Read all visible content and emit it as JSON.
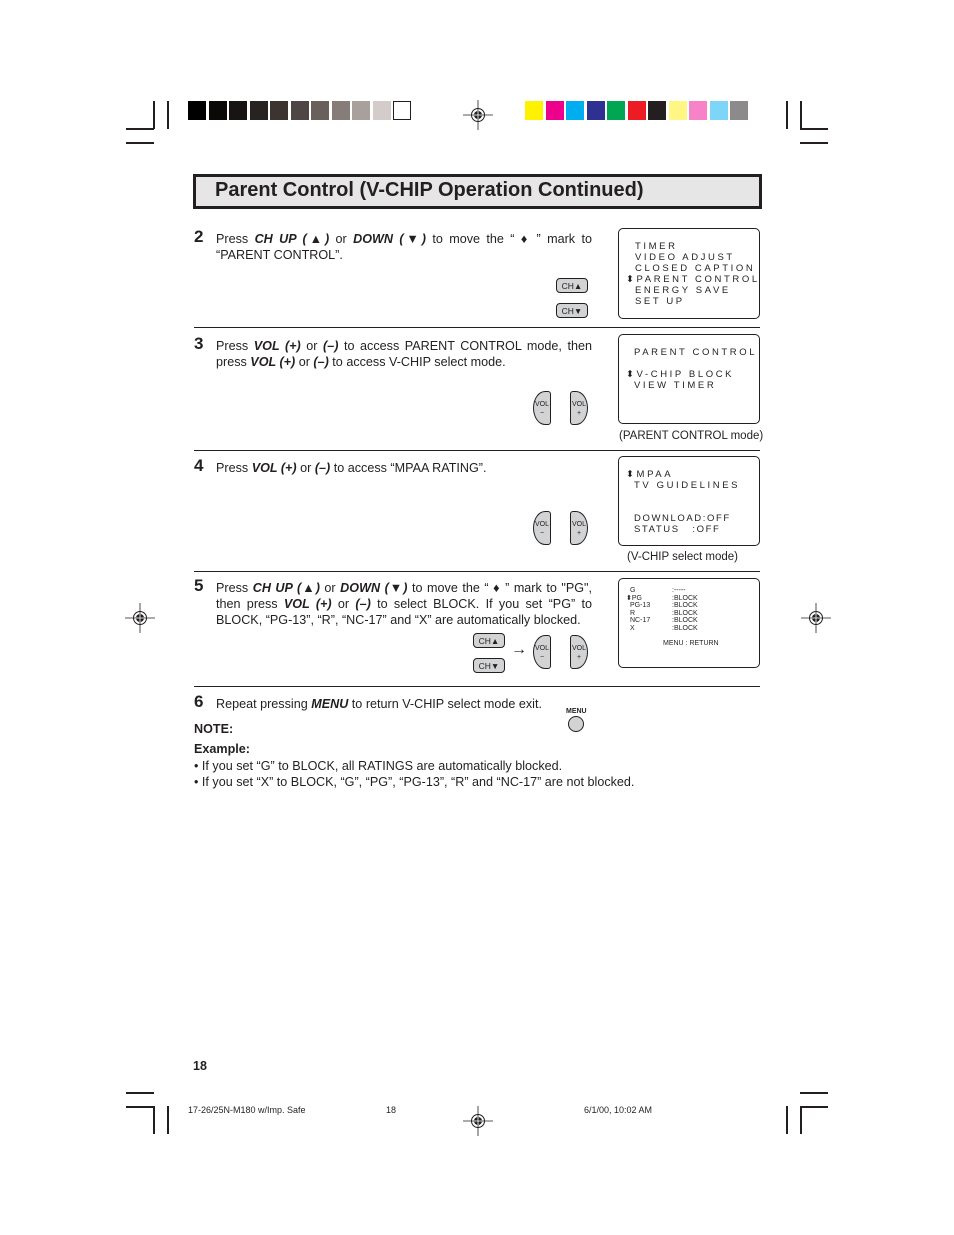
{
  "print_marks": {
    "gray_swatches": [
      "#000000",
      "#0a0908",
      "#171413",
      "#272320",
      "#3c3431",
      "#4e4644",
      "#6a605b",
      "#877d78",
      "#a8a09d",
      "#d4cccb",
      "#ffffff"
    ],
    "color_swatches": [
      "#fff200",
      "#ec008c",
      "#00aeef",
      "#2e3192",
      "#00a651",
      "#ed1c24",
      "#231f20",
      "#fff684",
      "#f683c7",
      "#7dd6f7",
      "#8c8a8a"
    ]
  },
  "header": {
    "title": "Parent Control (V-CHIP Operation Continued)"
  },
  "steps": [
    {
      "number": "2",
      "text_parts": [
        "Press ",
        "CH UP (▲)",
        " or ",
        "DOWN (▼)",
        "  to move the “ ♦ ” mark to “PARENT CONTROL”."
      ],
      "screen": {
        "lines": [
          "TIMER",
          "VIDEO ADJUST",
          "CLOSED CAPTION",
          "⬍PARENT CONTROL",
          "ENERGY SAVE",
          "SET UP"
        ],
        "selected_index": 3
      },
      "buttons": [
        "CH▲",
        "CH▼"
      ]
    },
    {
      "number": "3",
      "text_parts": [
        "Press ",
        "VOL (+)",
        " or ",
        "(–)",
        " to access PARENT CONTROL mode, then press ",
        "VOL (+)",
        " or ",
        "(–)",
        " to access V-CHIP select mode."
      ],
      "screen": {
        "lines": [
          "PARENT CONTROL",
          "",
          "⬍V-CHIP BLOCK",
          "VIEW TIMER"
        ],
        "caption": "(PARENT CONTROL mode)"
      },
      "buttons": [
        "VOL –",
        "VOL +"
      ]
    },
    {
      "number": "4",
      "text_parts": [
        "Press ",
        "VOL (+)",
        " or ",
        "(–)",
        " to access “MPAA RATING”."
      ],
      "screen": {
        "lines": [
          "⬍MPAA",
          "TV GUIDELINES",
          "",
          "",
          "DOWNLOAD:OFF",
          "STATUS   :OFF"
        ],
        "caption": "(V-CHIP select mode)"
      },
      "buttons": [
        "VOL –",
        "VOL +"
      ]
    },
    {
      "number": "5",
      "text_parts": [
        "Press ",
        "CH UP (▲)",
        " or ",
        "DOWN (▼)",
        " to move the “ ♦ ” mark to \"PG\", then press ",
        "VOL (+)",
        " or ",
        "(–)",
        " to select BLOCK. If you set “PG” to BLOCK, “PG-13”, “R”, “NC-17” and “X” are automatically blocked."
      ],
      "screen": {
        "ratings": [
          {
            "label": "G",
            "value": ":-----"
          },
          {
            "label": "⬍PG",
            "value": ":BLOCK"
          },
          {
            "label": "PG-13",
            "value": ":BLOCK"
          },
          {
            "label": "R",
            "value": ":BLOCK"
          },
          {
            "label": "NC-17",
            "value": ":BLOCK"
          },
          {
            "label": "X",
            "value": ":BLOCK"
          }
        ],
        "footer": "MENU : RETURN"
      },
      "buttons": [
        "CH▲",
        "CH▼",
        "VOL –",
        "VOL +"
      ],
      "arrow": "→"
    },
    {
      "number": "6",
      "text_parts": [
        "Repeat pressing ",
        "MENU",
        " to return V-CHIP select mode exit."
      ],
      "button_label": "MENU"
    }
  ],
  "note": {
    "label": "NOTE:",
    "example_label": "Example:",
    "bullets": [
      "•  If you set “G” to BLOCK, all RATINGS are automatically blocked.",
      "•  If you set “X” to BLOCK, “G”, “PG”, “PG-13”, “R” and “NC-17” are not blocked."
    ]
  },
  "page_number": "18",
  "footer": {
    "file": "17-26/25N-M180 w/Imp. Safe",
    "page": "18",
    "datetime": "6/1/00, 10:02 AM"
  }
}
